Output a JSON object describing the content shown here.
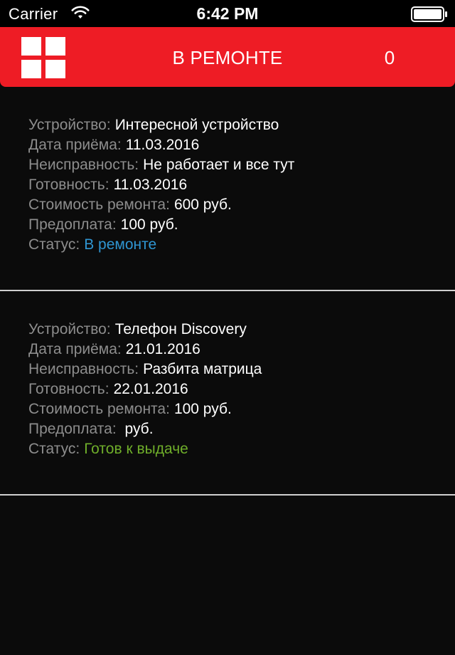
{
  "status_bar": {
    "carrier": "Carrier",
    "time": "6:42 PM",
    "wifi_icon": "wifi-icon",
    "battery_icon": "battery-icon"
  },
  "header": {
    "menu_icon": "grid-menu-icon",
    "title": "В РЕМОНТЕ",
    "count": "0",
    "background_color": "#ee1c25"
  },
  "colors": {
    "label": "#8d8d8d",
    "status_in_repair": "#2f95d1",
    "status_ready": "#6fae2a"
  },
  "orders": [
    {
      "device_label": "Устройство:",
      "device": "Интересной устройство",
      "received_label": "Дата приёма:",
      "received": "11.03.2016",
      "fault_label": "Неисправность:",
      "fault": "Не работает и все тут",
      "ready_label": "Готовность:",
      "ready": "11.03.2016",
      "cost_label": "Стоимость ремонта:",
      "cost": "600 руб.",
      "prepayment_label": "Предоплата:",
      "prepayment": "100 руб.",
      "status_label": "Статус:",
      "status": "В ремонте"
    },
    {
      "device_label": "Устройство:",
      "device": "Телефон Discovery",
      "received_label": "Дата приёма:",
      "received": "21.01.2016",
      "fault_label": "Неисправность:",
      "fault": "Разбита матрица",
      "ready_label": "Готовность:",
      "ready": "22.01.2016",
      "cost_label": "Стоимость ремонта:",
      "cost": "100 руб.",
      "prepayment_label": "Предоплата:",
      "prepayment": " руб.",
      "status_label": "Статус:",
      "status": "Готов к выдаче"
    }
  ]
}
